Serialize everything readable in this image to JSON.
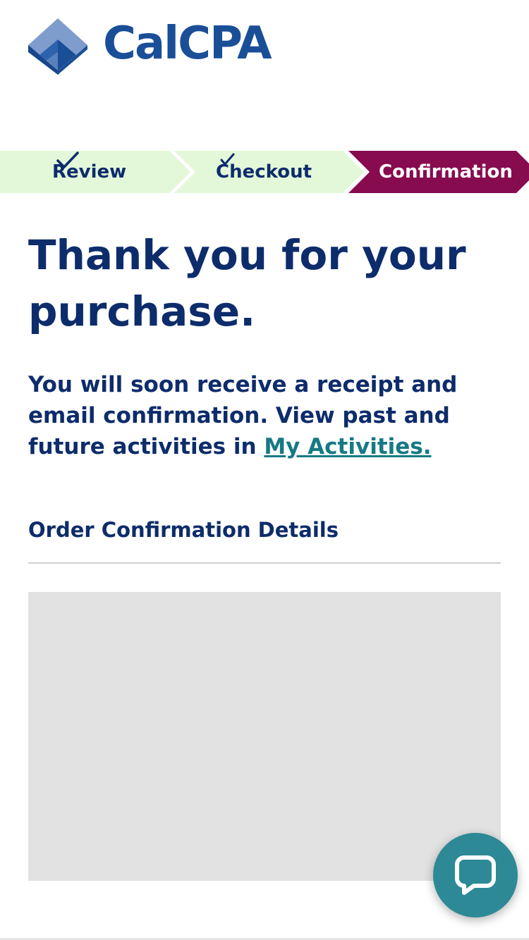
{
  "brand": {
    "logo_text": "CalCPA",
    "logo_icon": "calcpa-cube-logo",
    "color": "#1a4f97"
  },
  "steps": [
    {
      "label": "Review",
      "status": "complete",
      "icon": "check-icon"
    },
    {
      "label": "Checkout",
      "status": "complete",
      "icon": "check-icon"
    },
    {
      "label": "Confirmation",
      "status": "current"
    }
  ],
  "colors": {
    "heading": "#0d2c6b",
    "step_complete_bg": "#e3f8d8",
    "step_current_bg": "#870b4f",
    "link": "#167a85",
    "chat_button": "#2d8996",
    "placeholder": "#e2e2e2"
  },
  "main": {
    "headline": "Thank you for your purchase.",
    "message_text": "You will soon receive a receipt and email confirmation. View past and future activities in ",
    "message_link": "My Activities.",
    "section_title": "Order Confirmation Details"
  },
  "chat": {
    "icon": "chat-bubble-icon"
  }
}
